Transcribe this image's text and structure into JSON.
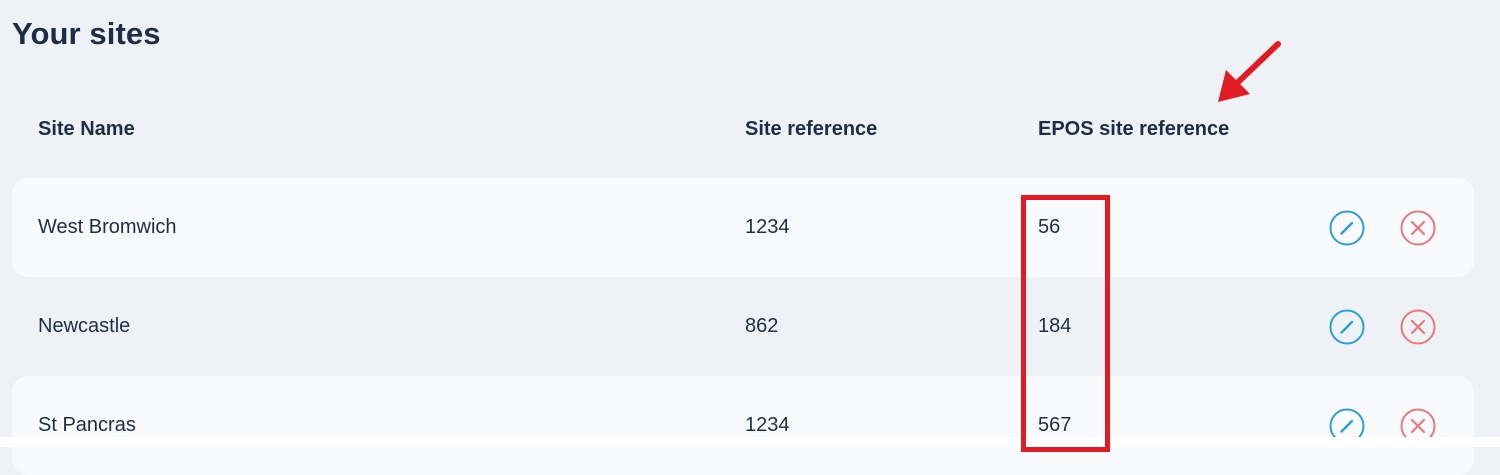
{
  "page": {
    "title": "Your sites"
  },
  "table": {
    "headers": {
      "site_name": "Site Name",
      "site_reference": "Site reference",
      "epos_site_reference": "EPOS site reference"
    },
    "rows": [
      {
        "site_name": "West Bromwich",
        "site_reference": "1234",
        "epos_site_reference": "56"
      },
      {
        "site_name": "Newcastle",
        "site_reference": "862",
        "epos_site_reference": "184"
      },
      {
        "site_name": "St Pancras",
        "site_reference": "1234",
        "epos_site_reference": "567"
      }
    ]
  },
  "actions": {
    "edit_icon": "pencil-icon",
    "delete_icon": "close-circle-icon"
  },
  "colors": {
    "background": "#eef2f6",
    "row_fill": "#f8fafb",
    "text": "#1e2d45",
    "edit_blue": "#2a9fd6",
    "delete_red": "#e8787a",
    "annotation_red": "#e01b24"
  }
}
